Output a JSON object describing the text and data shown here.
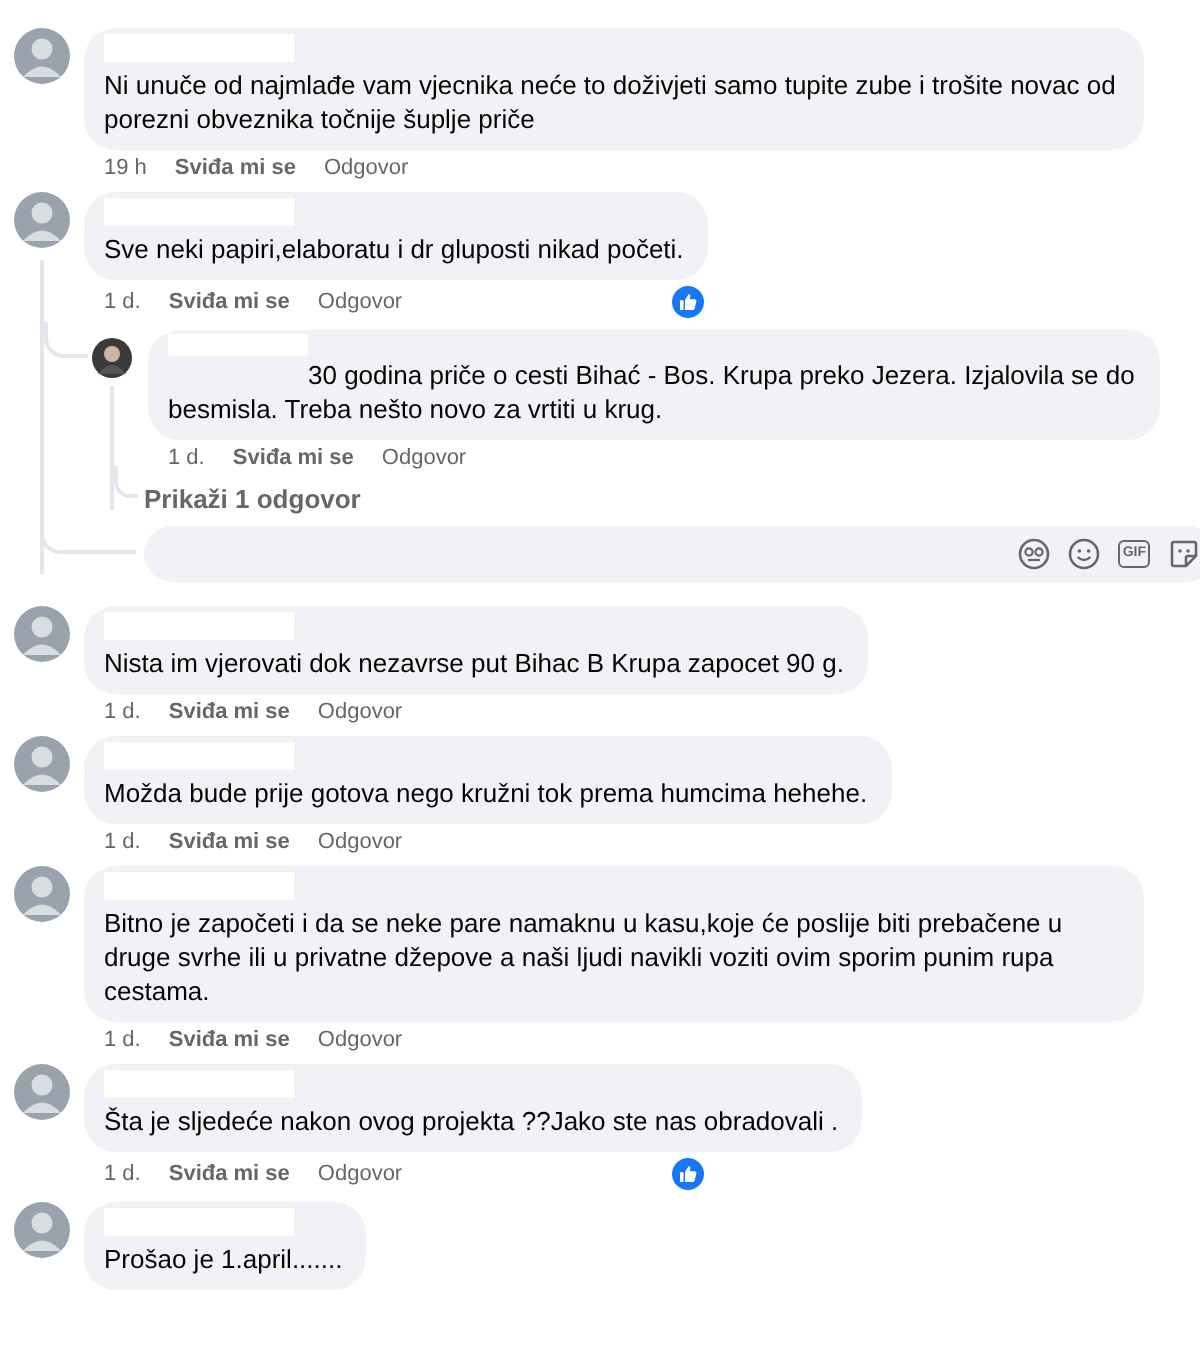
{
  "comments": [
    {
      "text": "Ni unuče od najmlađe vam vjecnika neće to doživjeti samo tupite zube i trošite novac od porezni obveznika točnije šuplje priče",
      "time": "19 h",
      "like": "Sviđa mi se",
      "reply": "Odgovor",
      "liked": false
    },
    {
      "text": "Sve neki papiri,elaboratu i dr gluposti nikad početi.",
      "time": "1 d.",
      "like": "Sviđa mi se",
      "reply": "Odgovor",
      "liked": true,
      "replies": [
        {
          "text": "30 godina priče o cesti Bihać - Bos. Krupa preko Jezera. Izjalovila se do besmisla. Treba nešto novo za vrtiti u krug.",
          "time": "1 d.",
          "like": "Sviđa mi se",
          "reply": "Odgovor",
          "liked": false
        }
      ],
      "show_replies": "Prikaži 1 odgovor",
      "reply_box": {
        "gif": "GIF"
      }
    },
    {
      "text": "Nista im vjerovati dok nezavrse put Bihac B Krupa zapocet 90 g.",
      "time": "1 d.",
      "like": "Sviđa mi se",
      "reply": "Odgovor",
      "liked": false
    },
    {
      "text": "Možda bude prije gotova nego kružni tok prema humcima hehehe.",
      "time": "1 d.",
      "like": "Sviđa mi se",
      "reply": "Odgovor",
      "liked": false
    },
    {
      "text": "Bitno je započeti i da se neke pare namaknu u kasu,koje će poslije biti prebačene u druge svrhe ili u privatne džepove a naši ljudi navikli voziti ovim sporim punim rupa cestama.",
      "time": "1 d.",
      "like": "Sviđa mi se",
      "reply": "Odgovor",
      "liked": false
    },
    {
      "text": "Šta je sljedeće nakon ovog projekta ??Jako ste nas obradovali .",
      "time": "1 d.",
      "like": "Sviđa mi se",
      "reply": "Odgovor",
      "liked": true
    },
    {
      "text": "Prošao je 1.april......."
    }
  ]
}
